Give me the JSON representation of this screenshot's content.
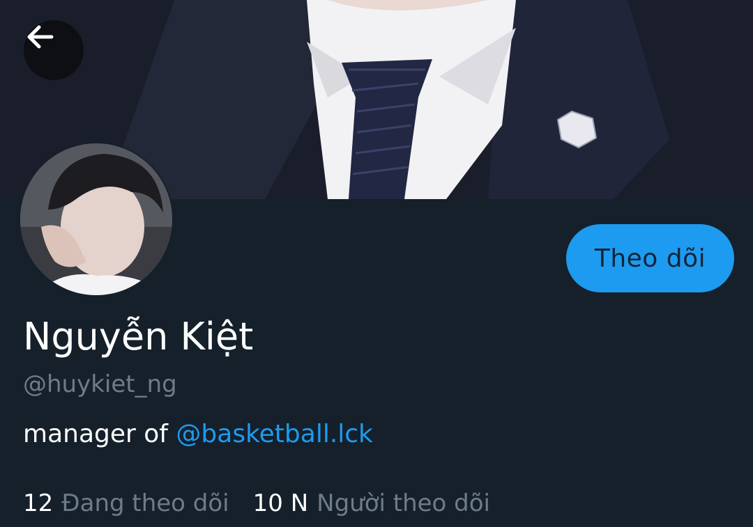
{
  "header": {
    "back_icon": "arrow-left-icon"
  },
  "profile": {
    "display_name": "Nguyễn Kiệt",
    "handle": "@huykiet_ng",
    "bio_text": "manager of ",
    "bio_mention": "@basketball.lck",
    "follow_label": "Theo dõi"
  },
  "stats": {
    "following_count": "12",
    "following_label": "Đang theo dõi",
    "followers_count": "10 N",
    "followers_label": "Người theo dõi"
  },
  "colors": {
    "background": "#15202b",
    "accent": "#1d9bf0",
    "muted_text": "#6e7c8a"
  }
}
